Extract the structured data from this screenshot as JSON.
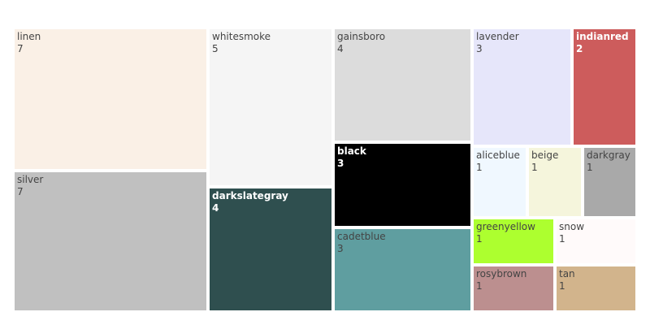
{
  "chart_data": {
    "type": "treemap",
    "items": [
      {
        "name": "linen",
        "value": 7,
        "color": "#faf0e6"
      },
      {
        "name": "silver",
        "value": 7,
        "color": "#c0c0c0"
      },
      {
        "name": "whitesmoke",
        "value": 5,
        "color": "#f5f5f5"
      },
      {
        "name": "darkslategray",
        "value": 4,
        "color": "#2f4f4f"
      },
      {
        "name": "gainsboro",
        "value": 4,
        "color": "#dcdcdc"
      },
      {
        "name": "black",
        "value": 3,
        "color": "#000000"
      },
      {
        "name": "cadetblue",
        "value": 3,
        "color": "#5f9ea0"
      },
      {
        "name": "lavender",
        "value": 3,
        "color": "#e6e6fa"
      },
      {
        "name": "indianred",
        "value": 2,
        "color": "#cd5c5c"
      },
      {
        "name": "aliceblue",
        "value": 1,
        "color": "#f0f8ff"
      },
      {
        "name": "beige",
        "value": 1,
        "color": "#f5f5dc"
      },
      {
        "name": "darkgray",
        "value": 1,
        "color": "#a9a9a9"
      },
      {
        "name": "greenyellow",
        "value": 1,
        "color": "#adff2f"
      },
      {
        "name": "snow",
        "value": 1,
        "color": "#fffafa"
      },
      {
        "name": "rosybrown",
        "value": 1,
        "color": "#bc8f8f"
      },
      {
        "name": "tan",
        "value": 1,
        "color": "#d2b48c"
      }
    ]
  }
}
